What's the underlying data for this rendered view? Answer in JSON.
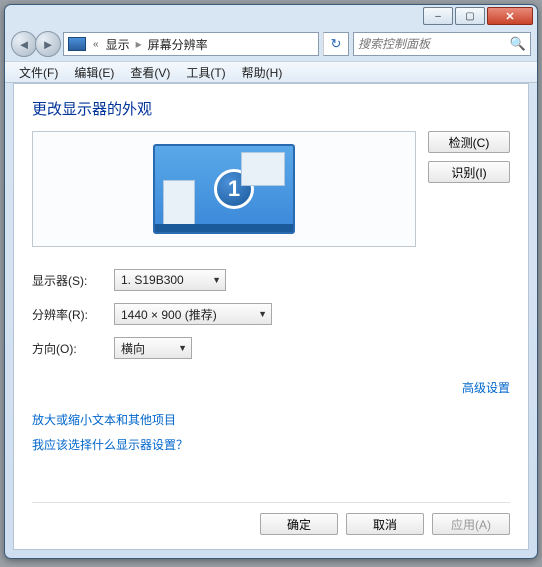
{
  "titlebar": {
    "min": "–",
    "max": "▢",
    "close": "✕"
  },
  "nav": {
    "back": "◄",
    "forward": "►",
    "crumb_prefix": "«",
    "crumb1": "显示",
    "crumb2": "屏幕分辨率",
    "refresh": "↻",
    "search_placeholder": "搜索控制面板",
    "search_icon": "🔍"
  },
  "menu": {
    "file": "文件(F)",
    "edit": "编辑(E)",
    "view": "查看(V)",
    "tools": "工具(T)",
    "help": "帮助(H)"
  },
  "heading": "更改显示器的外观",
  "preview": {
    "monitor_number": "1"
  },
  "buttons": {
    "detect": "检测(C)",
    "identify": "识别(I)"
  },
  "form": {
    "display_label": "显示器(S):",
    "display_value": "1. S19B300",
    "resolution_label": "分辨率(R):",
    "resolution_value": "1440 × 900 (推荐)",
    "orientation_label": "方向(O):",
    "orientation_value": "横向"
  },
  "links": {
    "advanced": "高级设置",
    "textsize": "放大或缩小文本和其他项目",
    "which": "我应该选择什么显示器设置？"
  },
  "dialog": {
    "ok": "确定",
    "cancel": "取消",
    "apply": "应用(A)"
  }
}
